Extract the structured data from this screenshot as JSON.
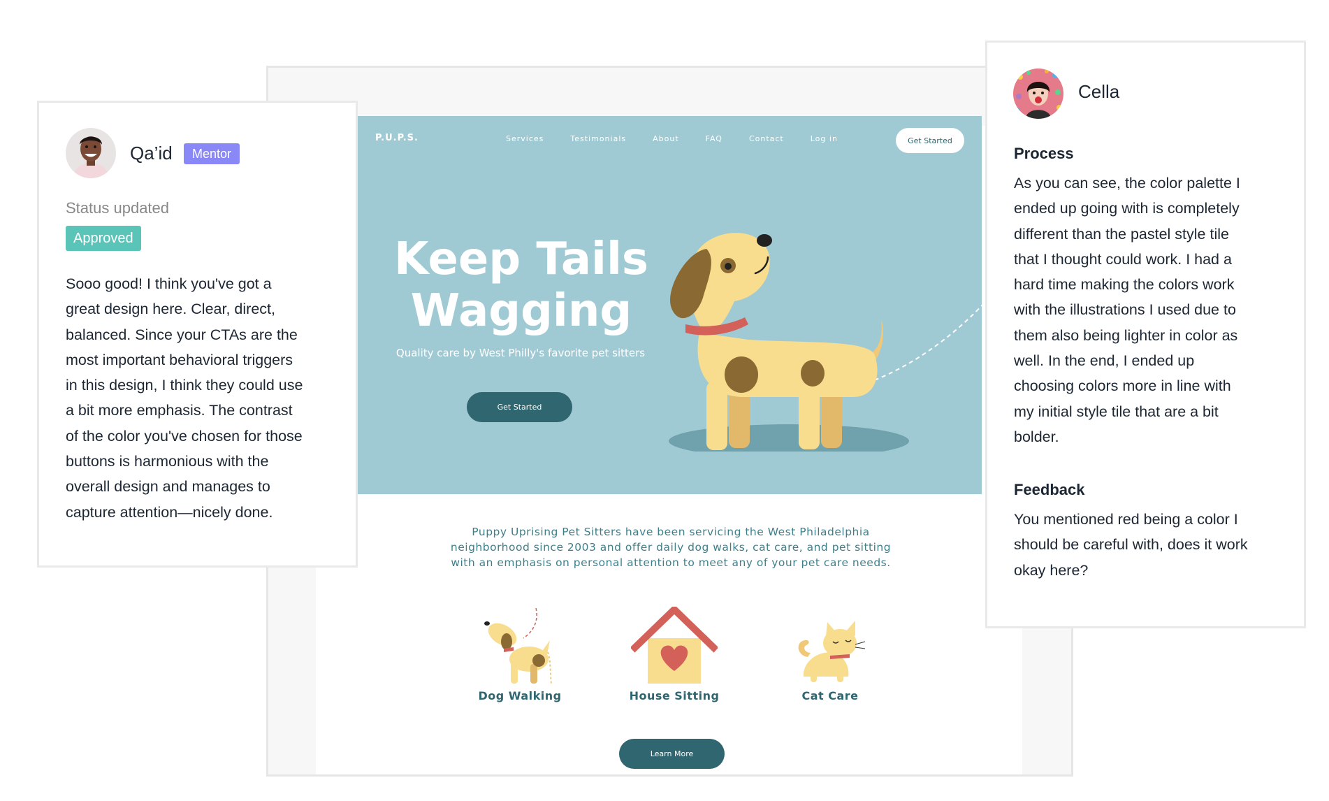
{
  "mockup": {
    "nav": {
      "logo": "P.U.P.S.",
      "links": [
        "Services",
        "Testimonials",
        "About",
        "FAQ",
        "Contact",
        "Log in"
      ],
      "cta": "Get Started"
    },
    "hero": {
      "title_line1": "Keep Tails",
      "title_line2": "Wagging",
      "subtitle": "Quality care by West Philly's favorite pet sitters",
      "cta": "Get Started"
    },
    "intro_lines": [
      "Puppy Uprising Pet Sitters have been servicing the West Philadelphia",
      "neighborhood since 2003 and offer daily dog walks, cat care, and pet sitting",
      "with an emphasis on personal attention to meet any of your pet care needs."
    ],
    "services": [
      {
        "label": "Dog Walking",
        "icon": "dog-walking-icon"
      },
      {
        "label": "House Sitting",
        "icon": "house-heart-icon"
      },
      {
        "label": "Cat Care",
        "icon": "cat-icon"
      }
    ],
    "learn_more": "Learn More",
    "colors": {
      "hero_bg": "#a0cad3",
      "primary": "#2f6670",
      "dog": "#f9dd8e",
      "accent_red": "#d4605a"
    }
  },
  "mentor_comment": {
    "name": "Qa’id",
    "badge": "Mentor",
    "status_label": "Status updated",
    "status": "Approved",
    "text_lines": [
      "Sooo good! I think you've got a",
      "great design here. Clear, direct,",
      "balanced. Since your CTAs are the",
      "most important behavioral triggers",
      "in this design, I think they could use",
      "a bit more emphasis. The contrast",
      "of the color you've chosen for those",
      "buttons is harmonious with the",
      "overall design and manages to",
      "capture attention—nicely done."
    ],
    "colors": {
      "badge": "#8a88f7",
      "approved": "#5bc4b8"
    }
  },
  "student_comment": {
    "name": "Cella",
    "process_heading": "Process",
    "process_lines": [
      "As you can see, the color palette I",
      "ended up going with is completely",
      "different than the pastel style tile",
      "that I thought could work. I had a",
      "hard time making the colors work",
      "with the illustrations I used due to",
      "them also being lighter in color as",
      "well. In the end, I ended up",
      "choosing colors more in line with",
      "my initial style tile that are a bit",
      "bolder."
    ],
    "feedback_heading": "Feedback",
    "feedback_lines": [
      "You mentioned red being a color I",
      "should be careful with, does it work",
      "okay here?"
    ]
  }
}
